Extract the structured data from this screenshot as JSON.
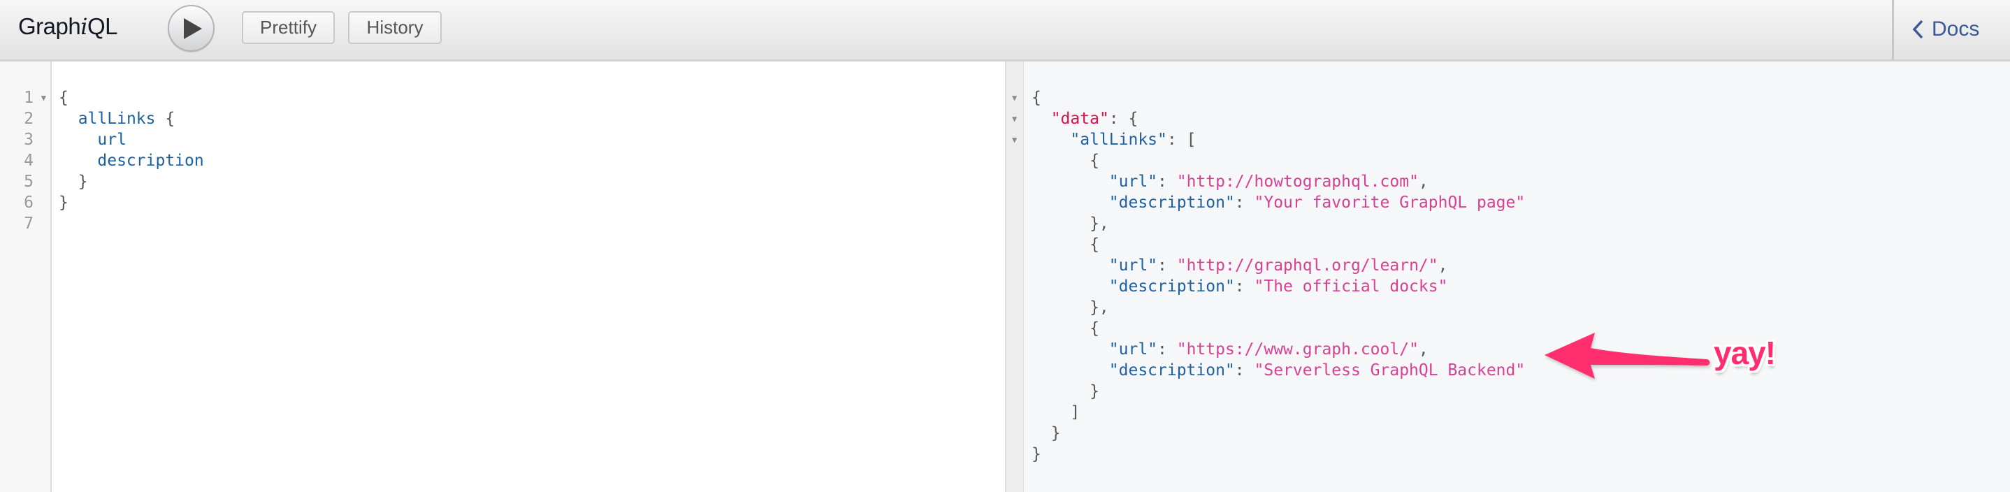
{
  "app": {
    "title_prefix": "Graph",
    "title_italic": "i",
    "title_suffix": "QL"
  },
  "toolbar": {
    "execute_icon": "play-icon",
    "prettify_label": "Prettify",
    "history_label": "History",
    "docs_label": "Docs",
    "docs_icon": "chevron-left-icon"
  },
  "query_editor": {
    "line_numbers": [
      "1",
      "2",
      "3",
      "4",
      "5",
      "6",
      "7"
    ],
    "fold_lines": [
      1
    ],
    "lines": [
      [
        {
          "t": "punct",
          "v": "{"
        }
      ],
      [
        {
          "t": "punct",
          "v": "  "
        },
        {
          "t": "field",
          "v": "allLinks"
        },
        {
          "t": "punct",
          "v": " {"
        }
      ],
      [
        {
          "t": "punct",
          "v": "    "
        },
        {
          "t": "field",
          "v": "url"
        }
      ],
      [
        {
          "t": "punct",
          "v": "    "
        },
        {
          "t": "field",
          "v": "description"
        }
      ],
      [
        {
          "t": "punct",
          "v": "  }"
        }
      ],
      [
        {
          "t": "punct",
          "v": "}"
        }
      ],
      []
    ]
  },
  "result_viewer": {
    "fold_lines": [
      1,
      2,
      3
    ],
    "lines": [
      [
        {
          "t": "punct",
          "v": "{"
        }
      ],
      [
        {
          "t": "punct",
          "v": "  "
        },
        {
          "t": "root",
          "v": "\"data\""
        },
        {
          "t": "punct",
          "v": ": {"
        }
      ],
      [
        {
          "t": "punct",
          "v": "    "
        },
        {
          "t": "key",
          "v": "\"allLinks\""
        },
        {
          "t": "punct",
          "v": ": ["
        }
      ],
      [
        {
          "t": "punct",
          "v": "      {"
        }
      ],
      [
        {
          "t": "punct",
          "v": "        "
        },
        {
          "t": "key",
          "v": "\"url\""
        },
        {
          "t": "punct",
          "v": ": "
        },
        {
          "t": "str",
          "v": "\"http://howtographql.com\""
        },
        {
          "t": "punct",
          "v": ","
        }
      ],
      [
        {
          "t": "punct",
          "v": "        "
        },
        {
          "t": "key",
          "v": "\"description\""
        },
        {
          "t": "punct",
          "v": ": "
        },
        {
          "t": "str",
          "v": "\"Your favorite GraphQL page\""
        }
      ],
      [
        {
          "t": "punct",
          "v": "      },"
        }
      ],
      [
        {
          "t": "punct",
          "v": "      {"
        }
      ],
      [
        {
          "t": "punct",
          "v": "        "
        },
        {
          "t": "key",
          "v": "\"url\""
        },
        {
          "t": "punct",
          "v": ": "
        },
        {
          "t": "str",
          "v": "\"http://graphql.org/learn/\""
        },
        {
          "t": "punct",
          "v": ","
        }
      ],
      [
        {
          "t": "punct",
          "v": "        "
        },
        {
          "t": "key",
          "v": "\"description\""
        },
        {
          "t": "punct",
          "v": ": "
        },
        {
          "t": "str",
          "v": "\"The official docks\""
        }
      ],
      [
        {
          "t": "punct",
          "v": "      },"
        }
      ],
      [
        {
          "t": "punct",
          "v": "      {"
        }
      ],
      [
        {
          "t": "punct",
          "v": "        "
        },
        {
          "t": "key",
          "v": "\"url\""
        },
        {
          "t": "punct",
          "v": ": "
        },
        {
          "t": "str",
          "v": "\"https://www.graph.cool/\""
        },
        {
          "t": "punct",
          "v": ","
        }
      ],
      [
        {
          "t": "punct",
          "v": "        "
        },
        {
          "t": "key",
          "v": "\"description\""
        },
        {
          "t": "punct",
          "v": ": "
        },
        {
          "t": "str",
          "v": "\"Serverless GraphQL Backend\""
        }
      ],
      [
        {
          "t": "punct",
          "v": "      }"
        }
      ],
      [
        {
          "t": "punct",
          "v": "    ]"
        }
      ],
      [
        {
          "t": "punct",
          "v": "  }"
        }
      ],
      [
        {
          "t": "punct",
          "v": "}"
        }
      ]
    ]
  },
  "annotation": {
    "text": "yay!",
    "arrow_icon": "arrow-left-icon",
    "color": "#ff2d6e"
  },
  "colors": {
    "field": "#1f61a0",
    "string": "#d64292",
    "root_key": "#e0124c",
    "punctuation": "#555555",
    "docs_link": "#3b5998"
  }
}
